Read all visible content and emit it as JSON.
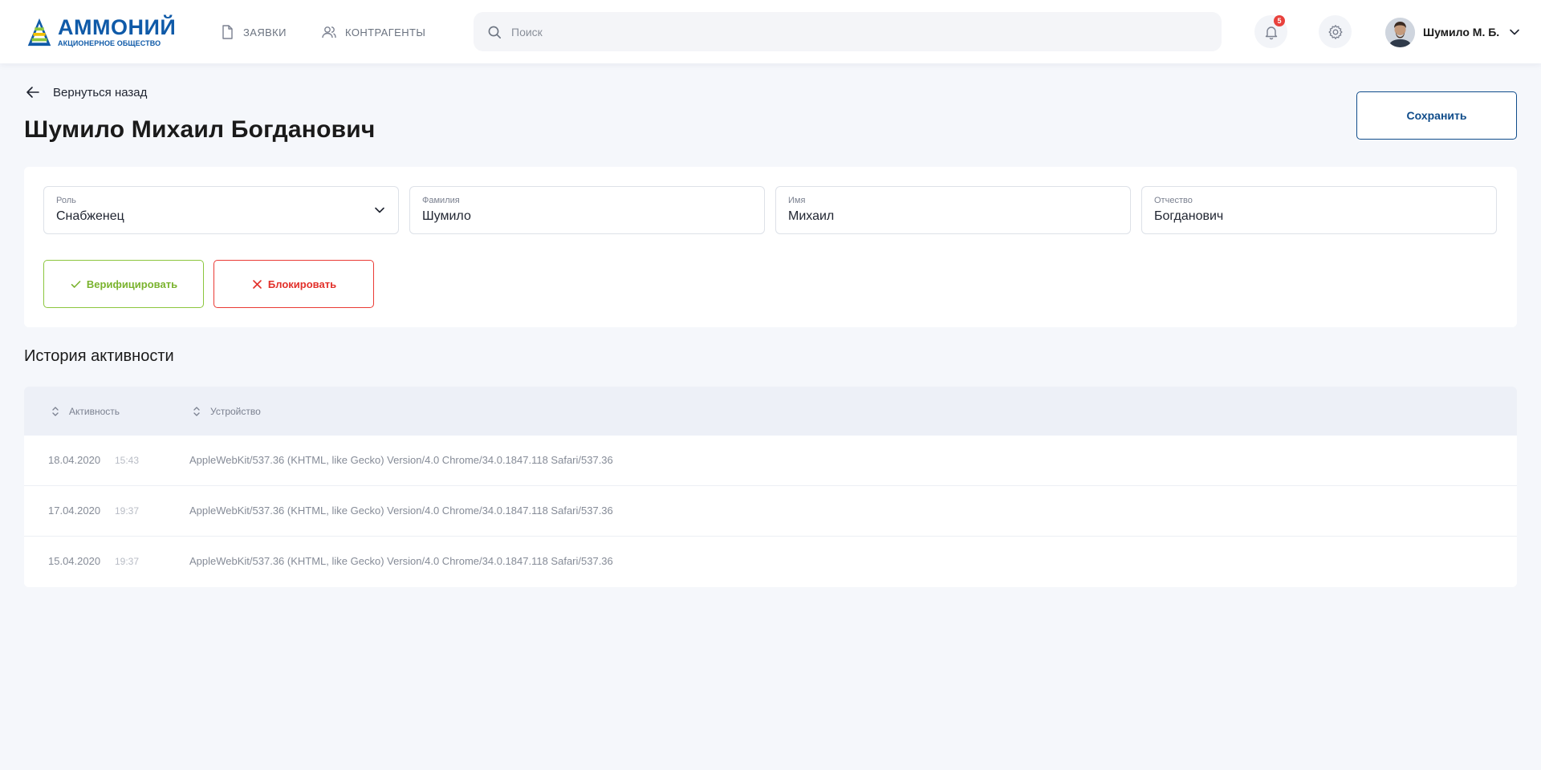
{
  "header": {
    "logo_title": "АММОНИЙ",
    "logo_subtitle": "АКЦИОНЕРНОЕ ОБЩЕСТВО",
    "nav": [
      {
        "label": "ЗАЯВКИ",
        "icon": "document-icon"
      },
      {
        "label": "КОНТРАГЕНТЫ",
        "icon": "users-icon"
      }
    ],
    "search_placeholder": "Поиск",
    "notifications_count": "5",
    "user_name": "Шумило М. Б."
  },
  "page": {
    "back_label": "Вернуться назад",
    "title": "Шумило Михаил Богданович",
    "save_label": "Сохранить"
  },
  "form": {
    "role": {
      "label": "Роль",
      "value": "Снабженец"
    },
    "surname": {
      "label": "Фамилия",
      "value": "Шумило"
    },
    "name": {
      "label": "Имя",
      "value": "Михаил"
    },
    "patronymic": {
      "label": "Отчество",
      "value": "Богданович"
    },
    "verify_label": "Верифицировать",
    "block_label": "Блокировать"
  },
  "history": {
    "title": "История активности",
    "columns": [
      "Активность",
      "Устройство"
    ],
    "rows": [
      {
        "date": "18.04.2020",
        "time": "15:43",
        "device": "AppleWebKit/537.36 (KHTML, like Gecko) Version/4.0 Chrome/34.0.1847.118 Safari/537.36"
      },
      {
        "date": "17.04.2020",
        "time": "19:37",
        "device": "AppleWebKit/537.36 (KHTML, like Gecko) Version/4.0 Chrome/34.0.1847.118 Safari/537.36"
      },
      {
        "date": "15.04.2020",
        "time": "19:37",
        "device": "AppleWebKit/537.36 (KHTML, like Gecko) Version/4.0 Chrome/34.0.1847.118 Safari/537.36"
      }
    ]
  },
  "colors": {
    "brand": "#0f5aa8",
    "verify": "#8cc63e",
    "block": "#ea3b35",
    "badge": "#e8413c"
  }
}
